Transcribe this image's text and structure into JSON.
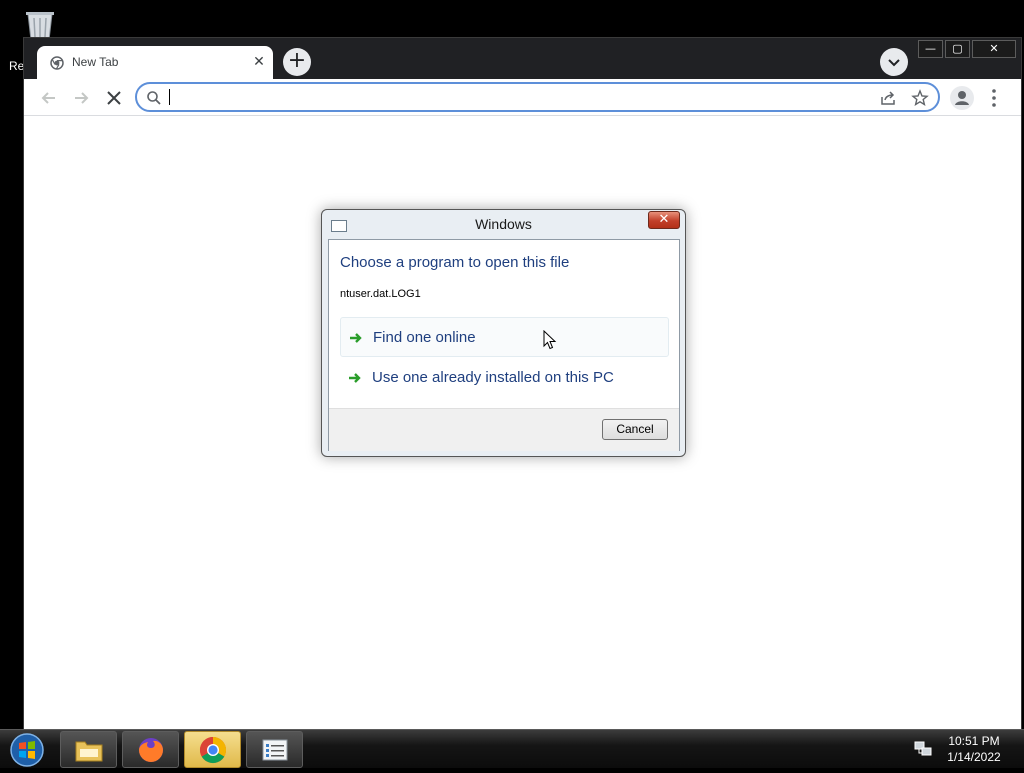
{
  "desktop": {
    "recycle_bin_label": "Re"
  },
  "browser": {
    "tab_title": "New Tab",
    "tab_close_glyph": "✕",
    "new_tab_glyph": "+",
    "omnibox_value": "",
    "omnibox_placeholder": "",
    "window_buttons": {
      "minimize": "—",
      "maximize": "▢",
      "close": "✕"
    }
  },
  "dialog": {
    "title": "Windows",
    "close_glyph": "✕",
    "heading": "Choose a program to open this file",
    "filename": "ntuser.dat.LOG1",
    "options": [
      {
        "label": "Find one online",
        "icon": "green-arrow-icon"
      },
      {
        "label": "Use one already installed on this PC",
        "icon": "green-arrow-icon"
      }
    ],
    "cancel_label": "Cancel"
  },
  "taskbar": {
    "items": [
      {
        "name": "file-explorer",
        "icon": "folder-icon"
      },
      {
        "name": "firefox",
        "icon": "firefox-icon"
      },
      {
        "name": "chrome",
        "icon": "chrome-icon",
        "active": true
      },
      {
        "name": "task-manager",
        "icon": "list-window-icon"
      }
    ],
    "clock_time": "10:51 PM",
    "clock_date": "1/14/2022"
  },
  "colors": {
    "dialog_link": "#1f3f7f",
    "omnibox_focus": "#5d8fd9",
    "taskbar_active": "#e0b94a",
    "arrow_green": "#2a9d2a"
  }
}
